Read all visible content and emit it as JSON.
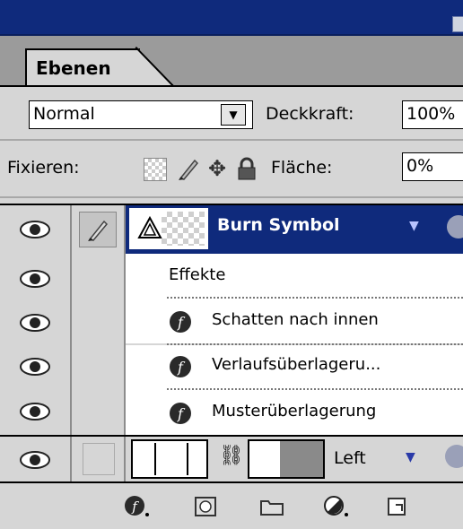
{
  "palette": {
    "tab_label": "Ebenen",
    "blend_mode": {
      "value": "Normal",
      "dropdown_glyph": "▼"
    },
    "opacity": {
      "label": "Deckkraft:",
      "value": "100%"
    },
    "lock": {
      "label": "Fixieren:",
      "icons": [
        "lock-transparency-icon",
        "lock-image-icon",
        "lock-position-icon",
        "lock-all-icon"
      ]
    },
    "fill": {
      "label": "Fläche:",
      "value": "0%"
    },
    "colors": {
      "title_bar": "#0f2a7c",
      "selected_row": "#0f2a7c",
      "panel": "#d6d6d6"
    }
  },
  "layers": [
    {
      "name": "Burn Symbol",
      "selected": true,
      "effects_label": "Effekte",
      "effects": [
        {
          "name": "Schatten nach innen"
        },
        {
          "name": "Verlaufsüberlageru..."
        },
        {
          "name": "Musterüberlagerung"
        }
      ]
    },
    {
      "name": "Left",
      "selected": false
    }
  ],
  "toolbar": {
    "buttons": [
      "layer-style-icon",
      "layer-mask-icon",
      "new-set-icon",
      "adjustment-layer-icon",
      "new-layer-icon"
    ]
  }
}
